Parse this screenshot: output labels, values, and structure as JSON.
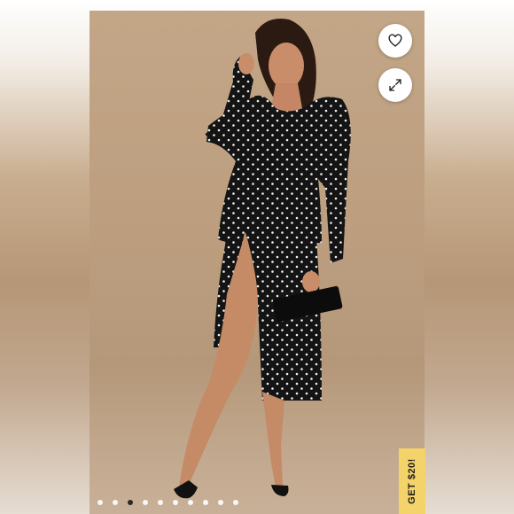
{
  "listing": {
    "image_count": 10,
    "active_image": 3
  },
  "actions": {
    "like_icon": "heart-icon",
    "expand_icon": "expand-icon"
  },
  "promo": {
    "label": "GET $20!",
    "color": "#f4d36a"
  }
}
